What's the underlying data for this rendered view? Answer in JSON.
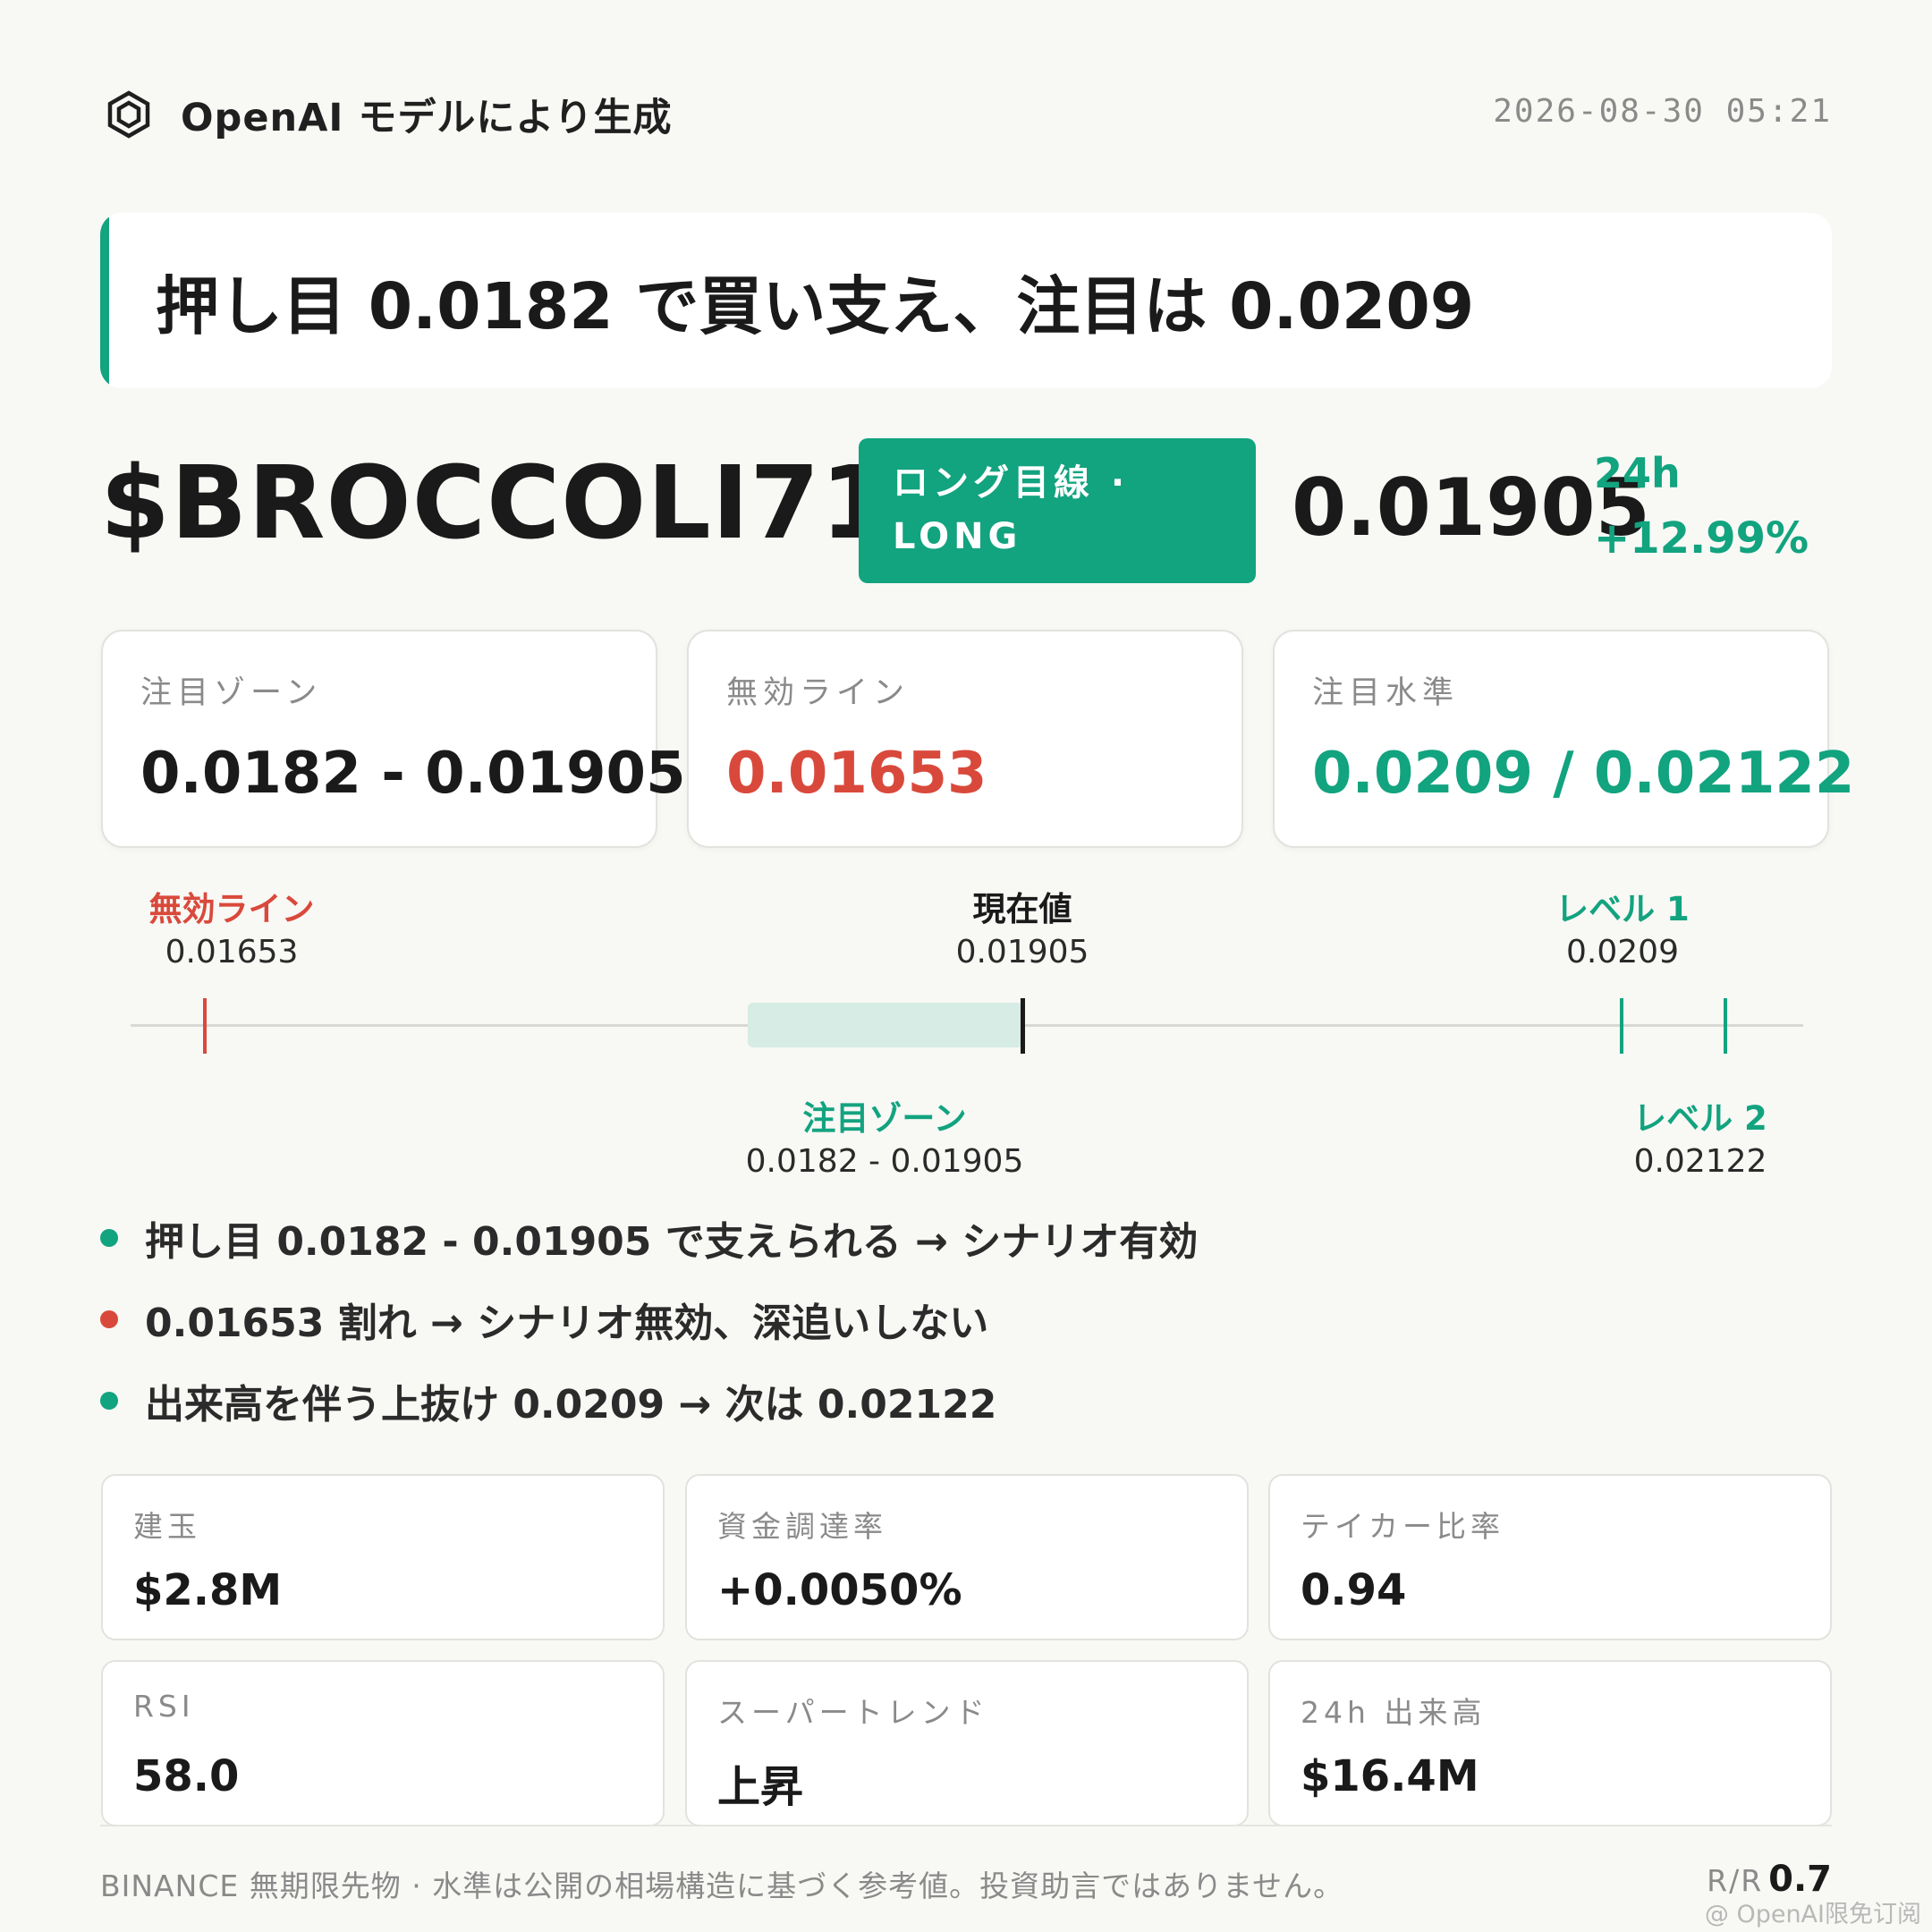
{
  "header": {
    "brand_icon": "openai-logo-icon",
    "brand_text": "OpenAI モデルにより生成",
    "timestamp": "2026-08-30 05:21"
  },
  "headline": "押し目 0.0182 で買い支え、注目は 0.0209",
  "ticker": {
    "symbol": "$BROCCOLI714",
    "side_line1": "ロング目線 ·",
    "side_line2": "LONG",
    "price": "0.01905",
    "change_label": "24h",
    "change_value": "+12.99%"
  },
  "levels": [
    {
      "label": "注目ゾーン",
      "value": "0.0182 - 0.01905",
      "color": "#1a1a1a"
    },
    {
      "label": "無効ライン",
      "value": "0.01653",
      "color": "#d9493b"
    },
    {
      "label": "注目水準",
      "value": "0.0209 / 0.02122",
      "color": "#12a37f"
    }
  ],
  "ladder": {
    "invalid": {
      "label": "無効ライン",
      "value": "0.01653"
    },
    "current": {
      "label": "現在値",
      "value": "0.01905"
    },
    "target1": {
      "label": "レベル 1",
      "value": "0.0209"
    },
    "zone": {
      "label": "注目ゾーン",
      "value": "0.0182 - 0.01905"
    },
    "target2": {
      "label": "レベル 2",
      "value": "0.02122"
    }
  },
  "bullets": [
    {
      "color": "#12a37f",
      "text": "押し目 0.0182 - 0.01905 で支えられる → シナリオ有効"
    },
    {
      "color": "#d9493b",
      "text": "0.01653 割れ → シナリオ無効、深追いしない"
    },
    {
      "color": "#12a37f",
      "text": "出来高を伴う上抜け 0.0209 → 次は 0.02122"
    }
  ],
  "stats": [
    {
      "label": "建玉",
      "value": "$2.8M"
    },
    {
      "label": "資金調達率",
      "value": "+0.0050%"
    },
    {
      "label": "テイカー比率",
      "value": "0.94"
    },
    {
      "label": "RSI",
      "value": "58.0"
    },
    {
      "label": "スーパートレンド",
      "value": "上昇"
    },
    {
      "label": "24h 出来高",
      "value": "$16.4M"
    }
  ],
  "footer": {
    "note": "BINANCE 無期限先物 · 水準は公開の相場構造に基づく参考値。投資助言ではありません。",
    "rr_label": "R/R",
    "rr_value": "0.7"
  },
  "watermark": "@ OpenAI限免订阅",
  "colors": {
    "accent": "#12a37f",
    "danger": "#d9493b",
    "text": "#1a1a1a"
  }
}
